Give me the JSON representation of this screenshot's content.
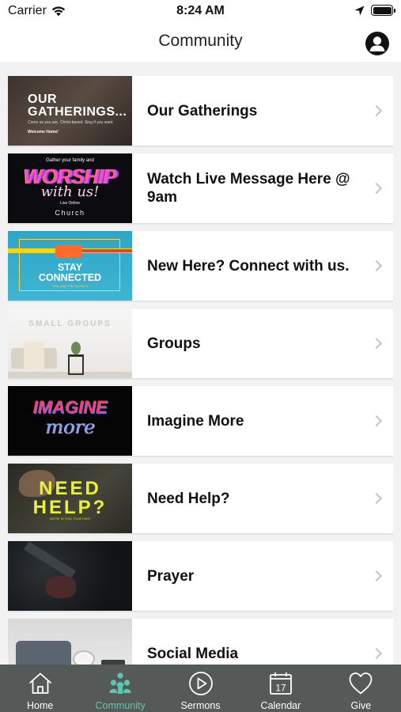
{
  "status_bar": {
    "carrier": "Carrier",
    "time": "8:24 AM"
  },
  "nav": {
    "title": "Community"
  },
  "items": [
    {
      "title": "Our Gatherings",
      "thumb": {
        "big": "OUR\nGATHERINGS...",
        "tiny": "Come as you are. Christ-based. Sing if you want.",
        "tiny2": "Welcome Home!"
      }
    },
    {
      "title": "Watch Live Message Here @ 9am",
      "thumb": {
        "top": "Gather your family and",
        "line1": "WORSHIP",
        "line2": "with us!",
        "live": "Live Online",
        "church": "Church"
      }
    },
    {
      "title": "New Here? Connect with us.",
      "thumb": {
        "text": "STAY\nCONNECTED",
        "small": "YOU ARE THE CHURCH"
      }
    },
    {
      "title": "Groups",
      "thumb": {
        "header": "SMALL GROUPS"
      }
    },
    {
      "title": "Imagine More",
      "thumb": {
        "line1": "IMAGINE",
        "line2": "more"
      }
    },
    {
      "title": "Need Help?",
      "thumb": {
        "line1": "NEED",
        "line2": "HELP?",
        "small": "WE'RE IN THIS TOGETHER"
      }
    },
    {
      "title": "Prayer",
      "thumb": {}
    },
    {
      "title": "Social Media",
      "thumb": {}
    }
  ],
  "tabs": [
    {
      "label": "Home",
      "icon": "home-icon"
    },
    {
      "label": "Community",
      "icon": "people-icon",
      "active": true
    },
    {
      "label": "Sermons",
      "icon": "play-circle-icon"
    },
    {
      "label": "Calendar",
      "icon": "calendar-icon",
      "day": "17"
    },
    {
      "label": "Give",
      "icon": "heart-icon"
    }
  ],
  "colors": {
    "tab_active": "#59c9b4",
    "tab_bar_bg": "#555a58",
    "list_bg": "#f2f2f2"
  }
}
